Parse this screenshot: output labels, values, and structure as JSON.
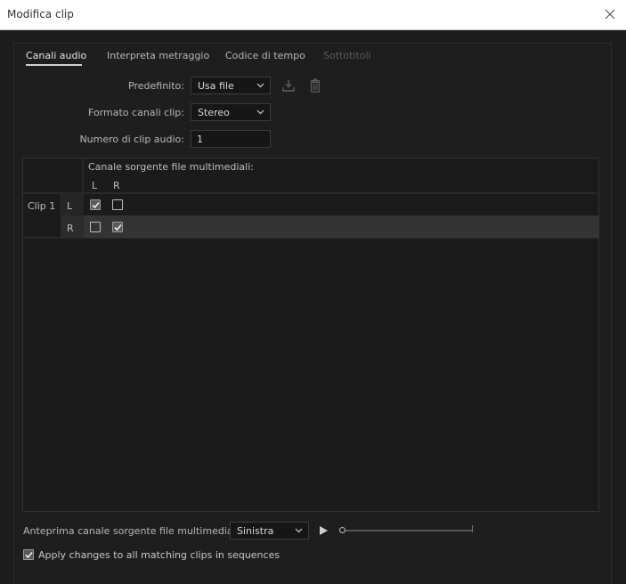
{
  "window": {
    "title": "Modifica clip"
  },
  "tabs": [
    {
      "label": "Canali audio",
      "state": "active"
    },
    {
      "label": "Interpreta metraggio",
      "state": "normal"
    },
    {
      "label": "Codice di tempo",
      "state": "normal"
    },
    {
      "label": "Sottotitoli",
      "state": "disabled"
    }
  ],
  "form": {
    "preset_label": "Predefinito:",
    "preset_value": "Usa file",
    "format_label": "Formato canali clip:",
    "format_value": "Stereo",
    "count_label": "Numero di clip audio:",
    "count_value": "1"
  },
  "grid": {
    "header": "Canale sorgente file multimediali:",
    "columns": [
      "L",
      "R"
    ],
    "clip_label": "Clip 1",
    "rows": [
      {
        "channel": "L",
        "checks": [
          true,
          false
        ]
      },
      {
        "channel": "R",
        "checks": [
          false,
          true
        ]
      }
    ]
  },
  "preview": {
    "label": "Anteprima canale sorgente file multimediali:",
    "channel_value": "Sinistra",
    "position": 0
  },
  "apply": {
    "label": "Apply changes to all matching clips in sequences",
    "checked": true
  },
  "icons": {
    "close": "close-icon",
    "save_preset": "download-icon",
    "delete_preset": "trash-icon",
    "play": "play-icon"
  }
}
